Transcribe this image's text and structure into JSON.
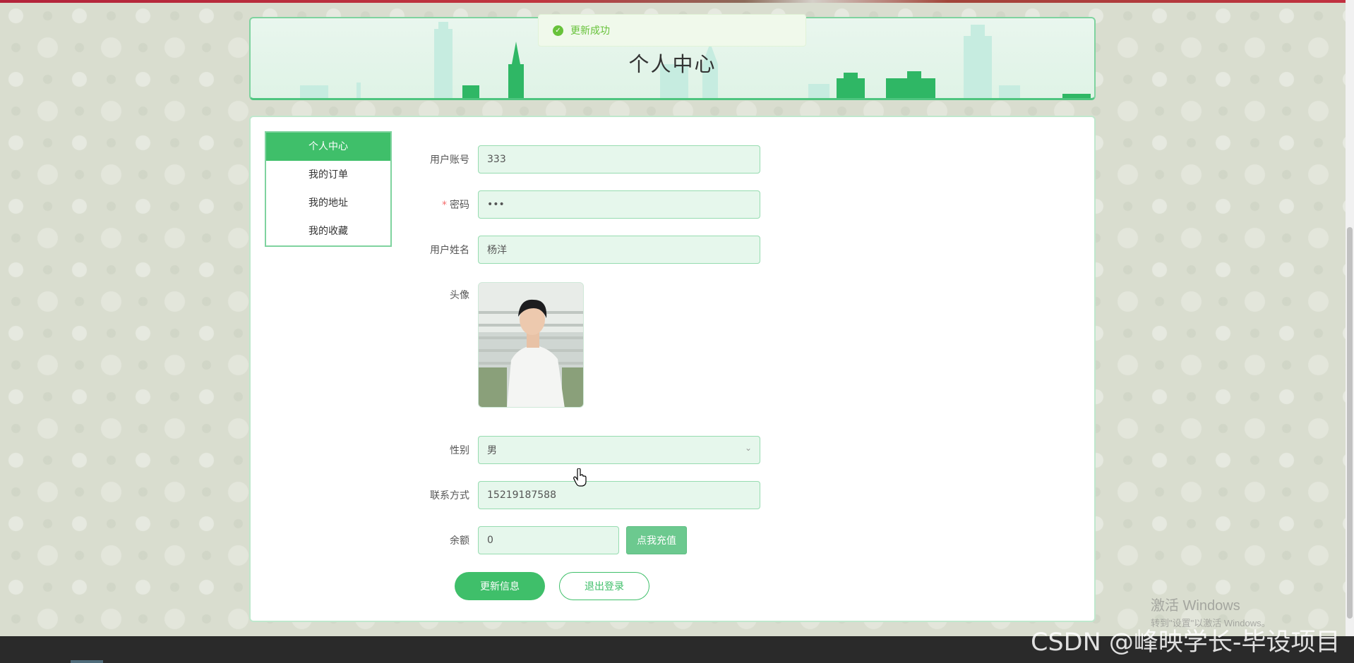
{
  "toast": {
    "message": "更新成功"
  },
  "header": {
    "title": "个人中心"
  },
  "sidebar": {
    "items": [
      {
        "label": "个人中心",
        "active": true
      },
      {
        "label": "我的订单",
        "active": false
      },
      {
        "label": "我的地址",
        "active": false
      },
      {
        "label": "我的收藏",
        "active": false
      }
    ]
  },
  "form": {
    "account": {
      "label": "用户账号",
      "value": "333"
    },
    "password": {
      "label": "密码",
      "value": "•••",
      "required": true
    },
    "name": {
      "label": "用户姓名",
      "value": "杨洋"
    },
    "avatar": {
      "label": "头像"
    },
    "gender": {
      "label": "性别",
      "value": "男"
    },
    "phone": {
      "label": "联系方式",
      "value": "15219187588"
    },
    "balance": {
      "label": "余额",
      "value": "0",
      "recharge_label": "点我充值"
    }
  },
  "actions": {
    "update_label": "更新信息",
    "logout_label": "退出登录"
  },
  "overlay": {
    "windows_activate_title": "激活 Windows",
    "windows_activate_sub": "转到\"设置\"以激活 Windows。",
    "csdn_watermark": "CSDN @峰映学长-毕设项目"
  },
  "colors": {
    "accent": "#3fbf6a",
    "success": "#67c23a",
    "input_bg": "#e6f7ec"
  }
}
